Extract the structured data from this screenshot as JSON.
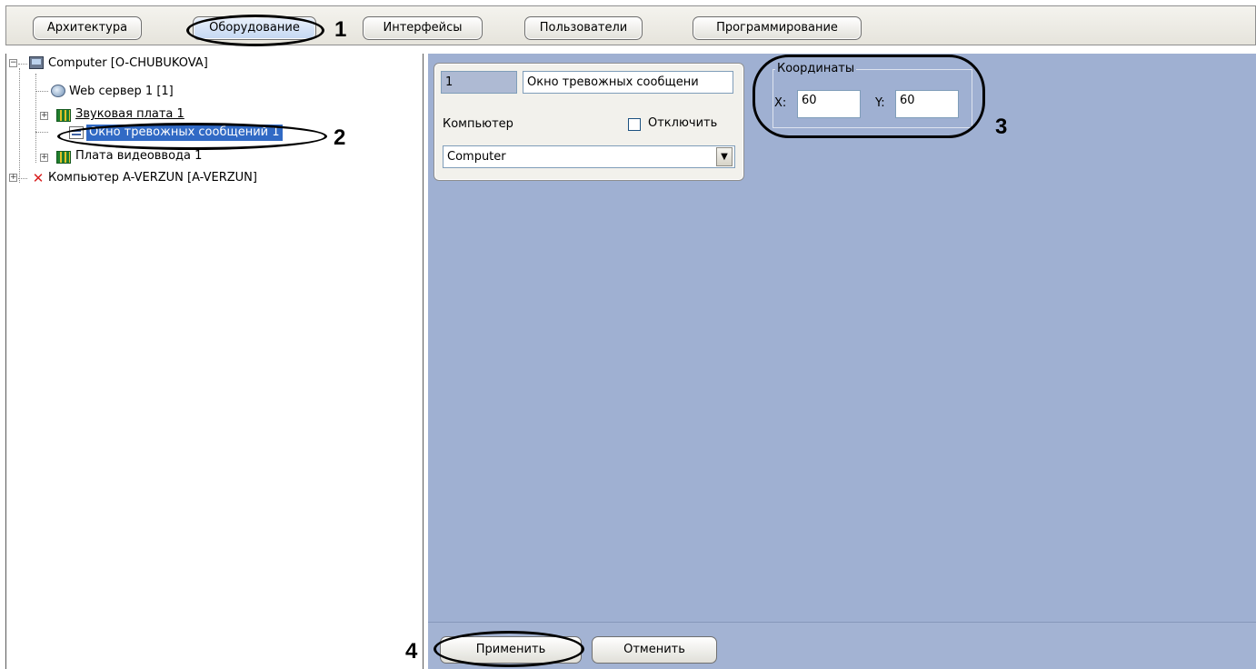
{
  "tabs": [
    {
      "label": "Архитектура"
    },
    {
      "label": "Оборудование"
    },
    {
      "label": "Интерфейсы"
    },
    {
      "label": "Пользователи"
    },
    {
      "label": "Программирование"
    }
  ],
  "markers": {
    "m1": "1",
    "m2": "2",
    "m3": "3",
    "m4": "4"
  },
  "tree": {
    "computer": "Computer [O-CHUBUKOVA]",
    "web_server": "Web сервер 1 [1]",
    "sound_card": "Звуковая плата 1",
    "alarm_window": "Окно тревожных сообщений 1",
    "video_card": "Плата видеоввода 1",
    "remote_computer": "Компьютер A-VERZUN [A-VERZUN]"
  },
  "form": {
    "id_value": "1",
    "name_value": "Окно тревожных сообщени",
    "computer_label": "Компьютер",
    "disable_label": "Отключить",
    "disable_checked": false,
    "computer_select": "Computer"
  },
  "coordinates": {
    "legend": "Координаты",
    "x_label": "X:",
    "x_value": "60",
    "y_label": "Y:",
    "y_value": "60"
  },
  "buttons": {
    "apply": "Применить",
    "cancel": "Отменить"
  },
  "colors": {
    "panel_bg": "#9fb0d2",
    "selection_bg": "#316ac5",
    "active_tab": "#c4d7f2"
  }
}
